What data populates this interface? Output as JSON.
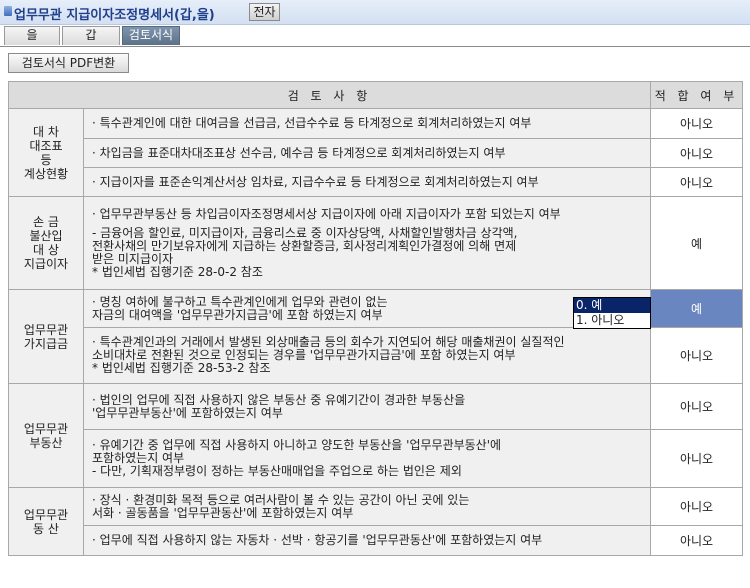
{
  "header": {
    "title": "업무무관 지급이자조정명세서(갑,을)",
    "jeonja_button": "전자"
  },
  "tabs": [
    {
      "label": "을",
      "active": false
    },
    {
      "label": "갑",
      "active": false
    },
    {
      "label": "검토서식",
      "active": true
    }
  ],
  "pdf_button": "검토서식 PDF변환",
  "table": {
    "headers": {
      "review_items": "검 토 사 항",
      "suitability": "적 합 여 부"
    },
    "categories": [
      {
        "lines": [
          "대  차",
          "대조표",
          "등",
          "계상현황"
        ]
      },
      {
        "lines": [
          "손  금",
          "불산입",
          "대  상",
          "지급이자"
        ]
      },
      {
        "lines": [
          "업무무관",
          "가지급금"
        ]
      },
      {
        "lines": [
          "업무무관",
          "부동산"
        ]
      },
      {
        "lines": [
          "업무무관",
          "동  산"
        ]
      }
    ],
    "rows": [
      {
        "lines": [
          "·  특수관계인에 대한 대여금을 선급금, 선급수수료 등 타계정으로 회계처리하였는지 여부"
        ],
        "result": "아니오"
      },
      {
        "lines": [
          "·  차입금을 표준대차대조표상 선수금, 예수금 등 타계정으로 회계처리하였는지 여부"
        ],
        "result": "아니오"
      },
      {
        "lines": [
          "·  지급이자를 표준손익계산서상 임차료, 지급수수료 등 타계정으로 회계처리하였는지 여부"
        ],
        "result": "아니오"
      },
      {
        "lines": [
          "·  업무무관부동산 등 차입금이자조정명세서상 지급이자에 아래 지급이자가 포함 되었는지 여부",
          "",
          "- 금융어음 할인료, 미지급이자, 금융리스료 중 이자상당액, 사채할인발행차금 상각액,",
          "  전환사채의 만기보유자에게 지급하는 상환할증금, 회사정리계획인가결정에 의해 면제",
          "  받은 미지급이자",
          "  * 법인세법 집행기준 28-0-2 참조"
        ],
        "result": "예"
      },
      {
        "lines": [
          "·  명칭 여하에 불구하고 특수관계인에게 업무와 관련이 없는",
          "  자금의 대여액을 '업무무관가지급금'에 포함 하였는지 여부"
        ],
        "result": "예"
      },
      {
        "lines": [
          "·  특수관계인과의 거래에서 발생된 외상매출금 등의 회수가 지연되어 해당 매출채권이 실질적인",
          "  소비대차로 전환된 것으로 인정되는 경우를 '업무무관가지급금'에 포함 하였는지 여부",
          "  * 법인세법 집행기준 28-53-2 참조"
        ],
        "result": "아니오"
      },
      {
        "lines": [
          "·  법인의 업무에 직접 사용하지 않은 부동산 중 유예기간이 경과한 부동산을",
          "  '업무무관부동산'에 포함하였는지 여부"
        ],
        "result": "아니오"
      },
      {
        "lines": [
          "·  유예기간 중 업무에 직접 사용하지 아니하고 양도한 부동산을 '업무무관부동산'에",
          "  포함하였는지 여부",
          "- 다만, 기획재정부령이 정하는 부동산매매업을 주업으로 하는 법인은 제외"
        ],
        "result": "아니오"
      },
      {
        "lines": [
          "·  장식 · 환경미화 목적 등으로 여러사람이 볼 수 있는 공간이 아닌 곳에 있는",
          "  서화 · 골동품을 '업무무관동산'에 포함하였는지 여부"
        ],
        "result": "아니오"
      },
      {
        "lines": [
          "·  업무에 직접 사용하지 않는 자동차 · 선박 · 항공기를  '업무무관동산'에 포함하였는지 여부"
        ],
        "result": "아니오"
      }
    ]
  },
  "dropdown": {
    "options": [
      "0. 예",
      "1. 아니오"
    ],
    "highlighted_index": 0
  }
}
